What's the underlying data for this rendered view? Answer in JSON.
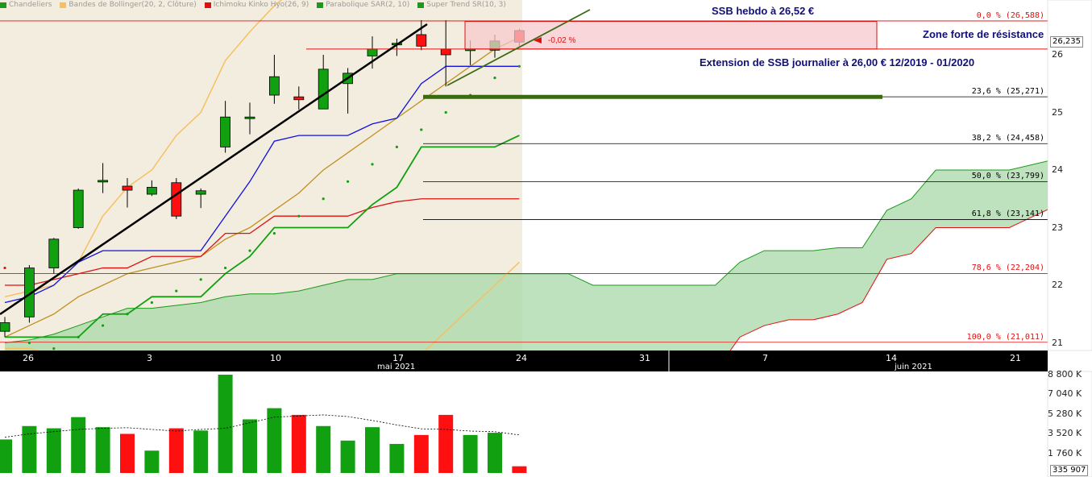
{
  "legend": [
    {
      "label": "Chandeliers",
      "color": "#1a9a1a"
    },
    {
      "label": "Bandes de Bollinger(20, 2, Clôture)",
      "color": "#f5c060"
    },
    {
      "label": "Ichimoku Kinko Hyo(26, 9)",
      "color": "#e01010"
    },
    {
      "label": "Parabolique SAR(2, 10)",
      "color": "#1a9a1a"
    },
    {
      "label": "Super Trend SR(10, 3)",
      "color": "#1a9a1a"
    }
  ],
  "annotations": {
    "ssb_weekly": "SSB hebdo à 26,52 €",
    "resistance_zone": "Zone forte de résistance",
    "ssb_extension": "Extension de SSB journalier à 26,00 € 12/2019 - 01/2020",
    "last_change": "-0,02 %"
  },
  "last_price_label": "26,235",
  "volume_last_label": "335 907",
  "colors": {
    "up": "#10a010",
    "down": "#ff1010",
    "cloud": "#a8d8a8",
    "trend": "#000000"
  },
  "chart_data": {
    "type": "candlestick",
    "title": "",
    "x_tick_labels": [
      "26",
      "3",
      "10",
      "17",
      "24",
      "31",
      "7",
      "14",
      "21"
    ],
    "x_month_labels": [
      "mai 2021",
      "juin 2021"
    ],
    "y_tick_labels": [
      "26",
      "25",
      "24",
      "23",
      "22",
      "21"
    ],
    "ylim": [
      20.9,
      26.85
    ],
    "candles": [
      {
        "o": 21.2,
        "h": 21.45,
        "l": 21.1,
        "c": 21.35
      },
      {
        "o": 21.45,
        "h": 22.35,
        "l": 21.35,
        "c": 22.3
      },
      {
        "o": 22.3,
        "h": 22.82,
        "l": 22.2,
        "c": 22.8
      },
      {
        "o": 23.0,
        "h": 23.68,
        "l": 22.98,
        "c": 23.65
      },
      {
        "o": 23.8,
        "h": 24.12,
        "l": 23.6,
        "c": 23.82
      },
      {
        "o": 23.72,
        "h": 23.86,
        "l": 23.35,
        "c": 23.65
      },
      {
        "o": 23.58,
        "h": 23.82,
        "l": 23.55,
        "c": 23.7
      },
      {
        "o": 23.78,
        "h": 23.86,
        "l": 23.15,
        "c": 23.2
      },
      {
        "o": 23.58,
        "h": 23.68,
        "l": 23.34,
        "c": 23.64
      },
      {
        "o": 24.4,
        "h": 25.2,
        "l": 24.3,
        "c": 24.92
      },
      {
        "o": 24.9,
        "h": 25.17,
        "l": 24.62,
        "c": 24.92
      },
      {
        "o": 25.3,
        "h": 26.0,
        "l": 25.15,
        "c": 25.62
      },
      {
        "o": 25.27,
        "h": 25.45,
        "l": 25.05,
        "c": 25.22
      },
      {
        "o": 25.06,
        "h": 26.0,
        "l": 25.06,
        "c": 25.75
      },
      {
        "o": 25.5,
        "h": 25.77,
        "l": 24.98,
        "c": 25.68
      },
      {
        "o": 25.98,
        "h": 26.32,
        "l": 25.76,
        "c": 26.1
      },
      {
        "o": 26.2,
        "h": 26.28,
        "l": 25.98,
        "c": 26.2
      },
      {
        "o": 26.35,
        "h": 26.6,
        "l": 26.08,
        "c": 26.15
      },
      {
        "o": 26.1,
        "h": 26.6,
        "l": 25.45,
        "c": 26.0
      },
      {
        "o": 26.1,
        "h": 26.25,
        "l": 25.82,
        "c": 26.1
      },
      {
        "o": 26.08,
        "h": 26.35,
        "l": 25.95,
        "c": 26.24
      },
      {
        "o": 26.42,
        "h": 26.45,
        "l": 26.15,
        "c": 26.22
      }
    ],
    "volumes": [
      3000,
      4200,
      4000,
      5000,
      4100,
      3500,
      2000,
      4000,
      3800,
      8800,
      4800,
      5800,
      5200,
      4200,
      2900,
      4100,
      2600,
      3400,
      5200,
      3400,
      3600,
      600
    ],
    "volume_avg": [
      3200,
      3500,
      3700,
      3900,
      4000,
      4050,
      3900,
      3750,
      3900,
      4000,
      4500,
      5000,
      5100,
      5200,
      5050,
      4700,
      4300,
      3950,
      3900,
      3750,
      3700,
      3400
    ],
    "volume_tick_labels": [
      "8 800 K",
      "7 040 K",
      "5 280 K",
      "3 520 K",
      "1 760 K"
    ],
    "volume_ylim": [
      0,
      8800
    ],
    "fibonacci": [
      {
        "label": "0,0 % (26,588)",
        "value": 26.588
      },
      {
        "label": "23,6 % (25,271)",
        "value": 25.271
      },
      {
        "label": "38,2 % (24,458)",
        "value": 24.458
      },
      {
        "label": "50,0 % (23,799)",
        "value": 23.799
      },
      {
        "label": "61,8 % (23,141)",
        "value": 23.141
      },
      {
        "label": "78,6 % (22,204)",
        "value": 22.204
      },
      {
        "label": "100,0 % (21,011)",
        "value": 21.011
      }
    ],
    "resistance_zone": [
      26.1,
      26.58
    ],
    "ssb_weekly_value": 26.52,
    "ssb_daily_extension": 25.27,
    "bollinger_upper": [
      21.8,
      21.9,
      22.0,
      22.4,
      23.2,
      23.7,
      24.0,
      24.6,
      25.0,
      25.9,
      26.4,
      26.85,
      27.2,
      27.4,
      27.5,
      27.6,
      27.7,
      27.8,
      27.9,
      27.9,
      28.0,
      28.0
    ],
    "bollinger_mid": [
      21.1,
      21.3,
      21.5,
      21.8,
      22.0,
      22.2,
      22.3,
      22.4,
      22.5,
      22.8,
      23.0,
      23.3,
      23.6,
      24.0,
      24.3,
      24.6,
      24.9,
      25.2,
      25.5,
      25.8,
      26.1,
      26.3
    ],
    "bollinger_lower": [
      20.9,
      20.9,
      20.8,
      20.7,
      20.6,
      20.5,
      20.4,
      20.4,
      20.3,
      20.2,
      20.1,
      20.0,
      20.0,
      20.1,
      20.2,
      20.3,
      20.5,
      20.8,
      21.2,
      21.6,
      22.0,
      22.4
    ],
    "kijun": [
      22.0,
      22.0,
      22.1,
      22.2,
      22.3,
      22.3,
      22.5,
      22.5,
      22.5,
      22.9,
      22.9,
      23.2,
      23.2,
      23.2,
      23.2,
      23.35,
      23.45,
      23.5,
      23.5,
      23.5,
      23.5,
      23.5
    ],
    "tenkan": [
      21.7,
      21.8,
      22.0,
      22.4,
      22.6,
      22.6,
      22.6,
      22.6,
      22.6,
      23.2,
      23.8,
      24.5,
      24.6,
      24.6,
      24.6,
      24.8,
      24.9,
      25.5,
      25.8,
      25.8,
      25.8,
      25.8
    ],
    "supertrend": [
      21.1,
      21.1,
      21.1,
      21.1,
      21.5,
      21.5,
      21.8,
      21.8,
      21.8,
      22.2,
      22.5,
      23.0,
      23.0,
      23.0,
      23.0,
      23.4,
      23.7,
      24.4,
      24.4,
      24.4,
      24.4,
      24.6
    ],
    "sar": [
      22.3,
      21.0,
      20.9,
      21.1,
      21.3,
      21.5,
      21.7,
      21.9,
      22.1,
      22.3,
      22.6,
      22.9,
      23.2,
      23.5,
      23.8,
      24.1,
      24.4,
      24.7,
      25.0,
      25.3,
      25.6,
      25.8
    ],
    "cloud_a": [
      21.0,
      21.05,
      21.15,
      21.3,
      21.45,
      21.6,
      21.6,
      21.65,
      21.7,
      21.8,
      21.85,
      21.85,
      21.9,
      22.0,
      22.1,
      22.1,
      22.2,
      22.2,
      22.2,
      22.2,
      22.2,
      22.2,
      22.2,
      22.2,
      22.0,
      22.0,
      22.0,
      22.0,
      22.0,
      22.0,
      22.4,
      22.6,
      22.6,
      22.6,
      22.65,
      22.65,
      23.3,
      23.5,
      24.0,
      24.0,
      24.0,
      24.0,
      24.1,
      24.2
    ],
    "cloud_b": [
      20.5,
      20.5,
      20.5,
      20.5,
      20.5,
      20.5,
      20.5,
      20.5,
      20.5,
      20.5,
      20.5,
      20.5,
      20.5,
      20.5,
      20.5,
      20.5,
      20.5,
      20.5,
      20.5,
      20.5,
      20.5,
      20.5,
      20.5,
      20.5,
      20.5,
      20.5,
      20.5,
      20.5,
      20.5,
      20.5,
      21.1,
      21.3,
      21.4,
      21.4,
      21.5,
      21.7,
      22.45,
      22.55,
      23.0,
      23.0,
      23.0,
      23.0,
      23.2,
      23.4
    ]
  }
}
